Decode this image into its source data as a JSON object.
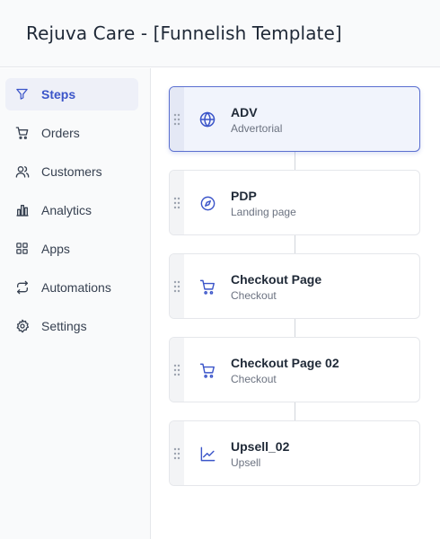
{
  "header": {
    "title": "Rejuva Care - [Funnelish Template]"
  },
  "sidebar": {
    "items": [
      {
        "label": "Steps",
        "icon": "filter-icon",
        "active": true
      },
      {
        "label": "Orders",
        "icon": "cart-icon"
      },
      {
        "label": "Customers",
        "icon": "users-icon"
      },
      {
        "label": "Analytics",
        "icon": "bar-chart-icon"
      },
      {
        "label": "Apps",
        "icon": "grid-icon"
      },
      {
        "label": "Automations",
        "icon": "repeat-icon"
      },
      {
        "label": "Settings",
        "icon": "gear-icon"
      }
    ]
  },
  "steps": [
    {
      "name": "ADV",
      "type": "Advertorial",
      "icon": "globe-icon",
      "active": true
    },
    {
      "name": "PDP",
      "type": "Landing page",
      "icon": "compass-icon"
    },
    {
      "name": "Checkout Page",
      "type": "Checkout",
      "icon": "cart-icon"
    },
    {
      "name": "Checkout Page 02",
      "type": "Checkout",
      "icon": "cart-icon"
    },
    {
      "name": "Upsell_02",
      "type": "Upsell",
      "icon": "trending-up-icon"
    }
  ],
  "colors": {
    "accent": "#3b55c9",
    "active_bg": "#eef0f8",
    "sidebar_bg": "#f9fafb",
    "border": "#e5e7eb"
  }
}
